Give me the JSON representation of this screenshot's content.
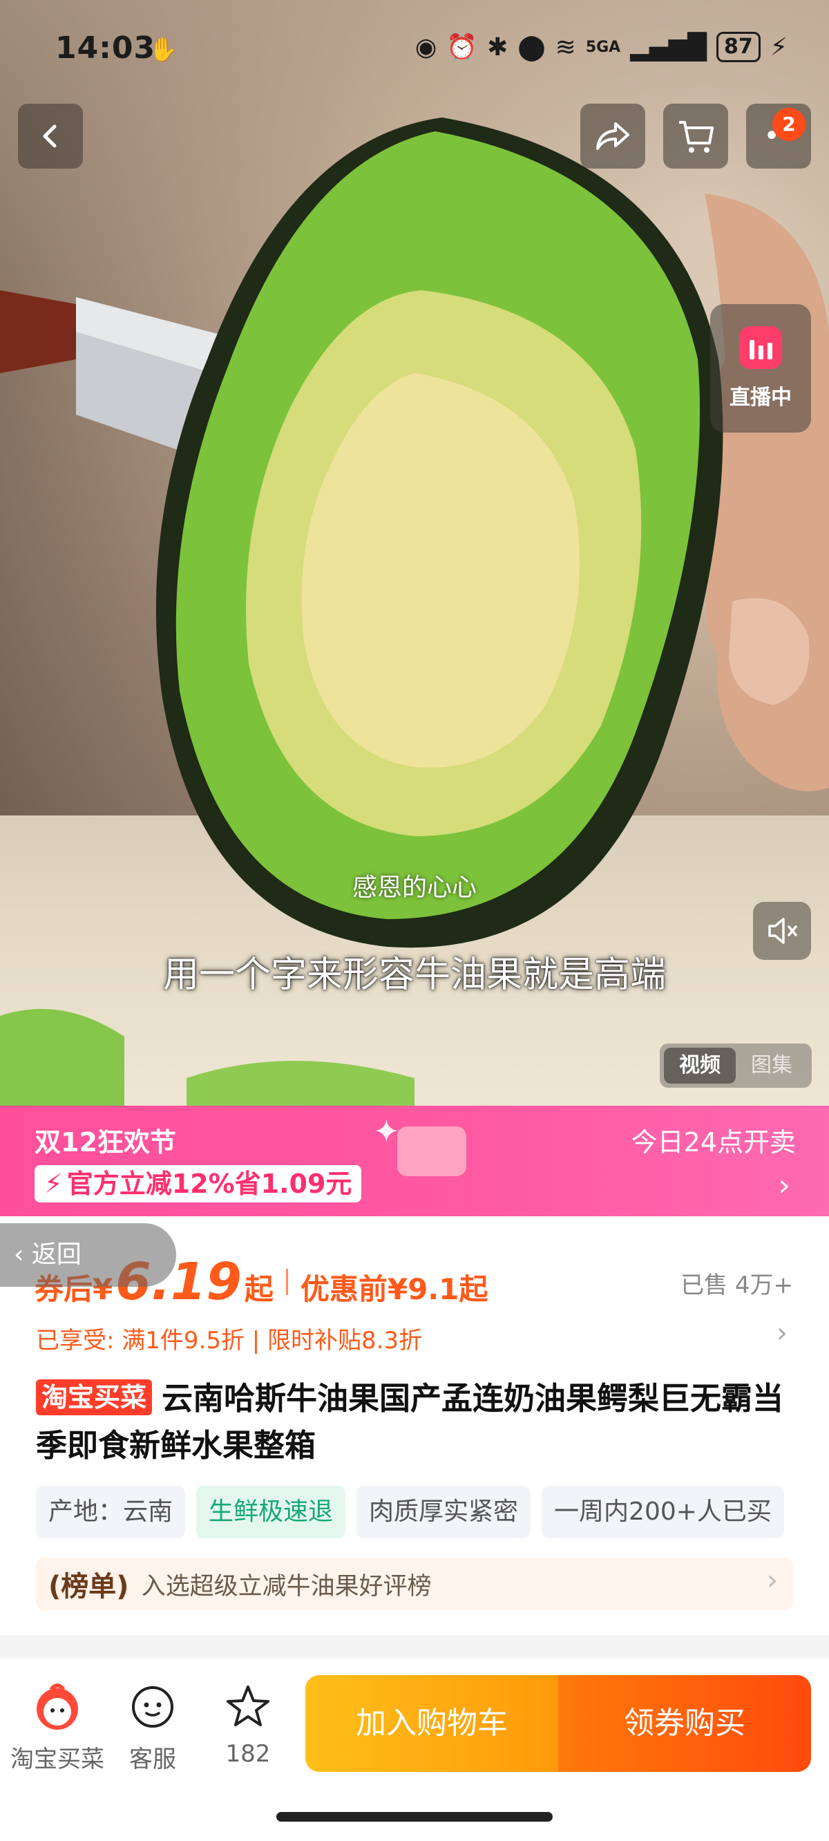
{
  "status_bar": {
    "time": "14:03",
    "battery": "87",
    "network": "5GA"
  },
  "top_bar": {
    "notification_count": "2"
  },
  "live": {
    "label": "直播中"
  },
  "video": {
    "subtitle_small": "感恩的心心",
    "subtitle_main": "用一个字来形容牛油果就是高端",
    "tabs": [
      "视频",
      "图集"
    ]
  },
  "promo": {
    "title": "双12狂欢节",
    "right_text": "今日24点开卖",
    "discount": "官方立减12%省1.09元"
  },
  "back_tab": {
    "label": "返回"
  },
  "price": {
    "after_label": "券后¥",
    "after_value": "6.19",
    "after_suffix": "起",
    "before": "优惠前¥9.1起",
    "sold": "已售 4万+",
    "enjoy": "已享受: 满1件9.5折 | 限时补贴8.3折"
  },
  "product": {
    "tag": "淘宝买菜",
    "title": "云南哈斯牛油果国产孟连奶油果鳄梨巨无霸当季即食新鲜水果整箱"
  },
  "chips": [
    "产地：云南",
    "生鲜极速退",
    "肉质厚实紧密",
    "一周内200+人已买"
  ],
  "rank": {
    "label": "榜单",
    "text": "入选超级立减牛油果好评榜"
  },
  "bottom": {
    "shop_label": "淘宝买菜",
    "service_label": "客服",
    "fav_count": "182",
    "add_cart": "加入购物车",
    "buy": "领券购买"
  },
  "colors": {
    "accent": "#ff5a1a",
    "promo_pink": "#ff4f9a",
    "cart_yellow": "#ffbf1a",
    "buy_orange": "#ff4a0c"
  }
}
